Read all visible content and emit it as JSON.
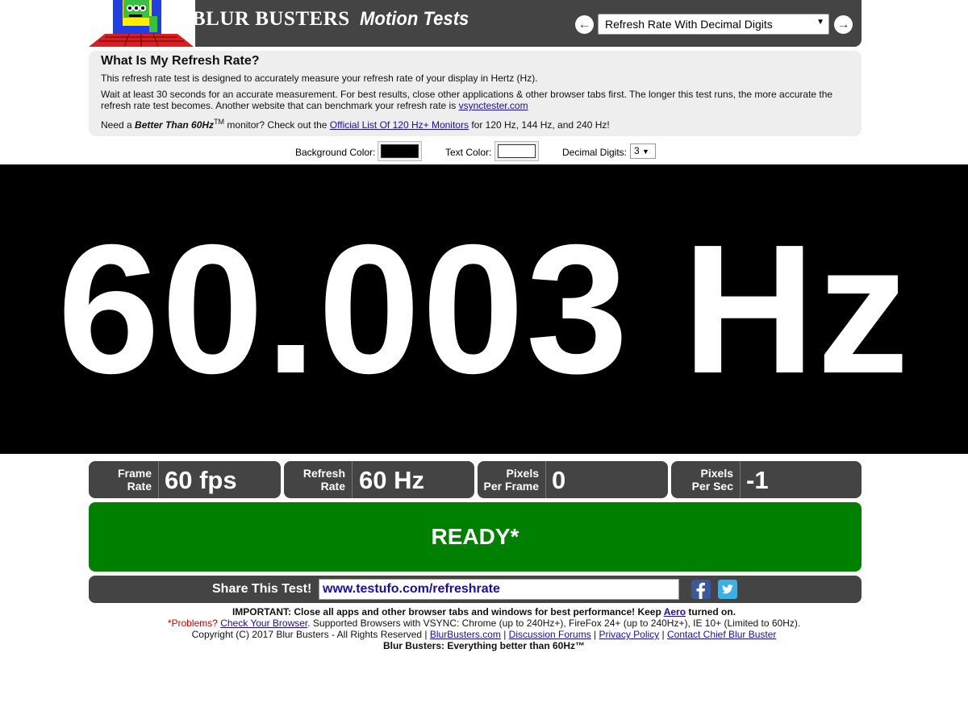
{
  "header": {
    "brand": "BLUR BUSTERS",
    "subtitle": "Motion Tests",
    "selected_test": "Refresh Rate With Decimal Digits"
  },
  "info": {
    "title": "What Is My Refresh Rate?",
    "p1": "This refresh rate test is designed to accurately measure your refresh rate of your display in Hertz (Hz).",
    "p2_text": "Wait at least 30 seconds for an accurate measurement. For best results, close other applications & other browser tabs first. The longer this test runs, the more accurate the refresh rate test becomes. Another website that can benchmark your refresh rate is ",
    "p2_link": "vsynctester.com",
    "p3_prefix": "Need a ",
    "p3_bold": "Better Than 60Hz",
    "p3_tm": "TM",
    "p3_mid": " monitor? Check out the ",
    "p3_link": "Official List Of 120 Hz+ Monitors",
    "p3_suffix": " for 120 Hz, 144 Hz, and 240 Hz!"
  },
  "controls": {
    "bg_label": "Background Color:",
    "bg_color": "#000000",
    "text_label": "Text Color:",
    "text_color": "#ffffff",
    "digits_label": "Decimal Digits:",
    "digits_value": "3"
  },
  "readout": "60.003 Hz",
  "stats": {
    "frame_rate_label1": "Frame",
    "frame_rate_label2": "Rate",
    "frame_rate_value": "60 fps",
    "refresh_rate_label1": "Refresh",
    "refresh_rate_label2": "Rate",
    "refresh_rate_value": "60 Hz",
    "pixels_frame_label1": "Pixels",
    "pixels_frame_label2": "Per Frame",
    "pixels_frame_value": "0",
    "pixels_sec_label1": "Pixels",
    "pixels_sec_label2": "Per Sec",
    "pixels_sec_value": "-1"
  },
  "status": "READY*",
  "share": {
    "label": "Share This Test!",
    "url": "www.testufo.com/refreshrate"
  },
  "footer": {
    "important_label": "IMPORTANT:",
    "important_text": " Close all apps and other browser tabs and windows for best performance! Keep ",
    "aero_link": "Aero",
    "important_suffix": " turned on.",
    "problems_prefix": "*Problems? ",
    "check_browser_link": "Check Your Browser",
    "problems_text": ". Supported Browsers with VSYNC: Chrome (up to 240Hz+), FireFox 24+ (up to 240Hz+), IE 10+ (Limited to 60Hz).",
    "copyright": "Copyright (C) 2017 Blur Busters - All Rights Reserved | ",
    "link_blurbusters": "BlurBusters.com",
    "sep": " | ",
    "link_forums": "Discussion Forums",
    "link_privacy": "Privacy Policy",
    "link_contact": "Contact Chief Blur Buster",
    "tagline": "Blur Busters: Everything better than 60Hz™"
  },
  "colors": {
    "header_bg": "#444444",
    "ready_bg": "#008000",
    "link": "#1a0dab"
  }
}
